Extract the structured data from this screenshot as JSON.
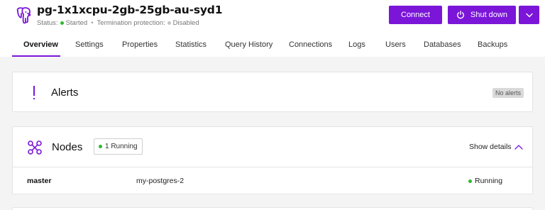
{
  "header": {
    "title": "pg-1x1xcpu-2gb-25gb-au-syd1",
    "status_label": "Status:",
    "status_value": "Started",
    "termination_label": "Termination protection:",
    "termination_value": "Disabled",
    "status_color": "#2eb82e",
    "brand_color": "#7b16d9"
  },
  "actions": {
    "connect_label": "Connect",
    "shutdown_label": "Shut down",
    "shutdown_icon": "power-icon",
    "dropdown_icon": "chevron-down-icon"
  },
  "tabs": [
    {
      "label": "Overview",
      "active": true
    },
    {
      "label": "Settings"
    },
    {
      "label": "Properties"
    },
    {
      "label": "Statistics"
    },
    {
      "label": "Query History"
    },
    {
      "label": "Connections"
    },
    {
      "label": "Logs"
    },
    {
      "label": "Users"
    },
    {
      "label": "Databases"
    },
    {
      "label": "Backups"
    }
  ],
  "alerts": {
    "title": "Alerts",
    "badge": "No alerts",
    "icon": "exclamation-icon"
  },
  "nodes": {
    "title": "Nodes",
    "icon": "nodes-icon",
    "running_badge": "1 Running",
    "show_details_label": "Show details",
    "rows": [
      {
        "name": "master",
        "host": "my-postgres-2",
        "status": "Running"
      }
    ]
  }
}
